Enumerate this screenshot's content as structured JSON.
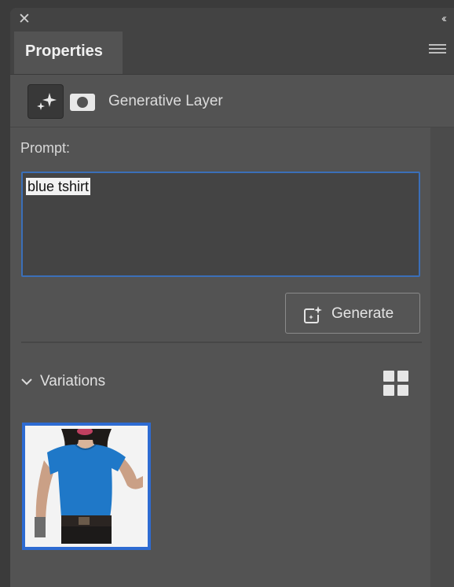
{
  "topbar": {
    "close_glyph": "✕",
    "collapse_glyph": "‹‹"
  },
  "tabs": [
    {
      "label": "Properties",
      "active": true
    }
  ],
  "menu_icon": "hamburger-menu-icon",
  "layer": {
    "title": "Generative Layer",
    "type_icon": "sparkle-icon",
    "mask_icon": "layer-mask-icon"
  },
  "prompt": {
    "label": "Prompt:",
    "value": "blue tshirt",
    "selected": true
  },
  "generate_button": {
    "label": "Generate",
    "icon": "generate-sparkle-icon"
  },
  "variations": {
    "label": "Variations",
    "expanded": true,
    "view_icon": "grid-view-icon",
    "items": [
      {
        "description": "person in blue t-shirt",
        "selected": true
      }
    ]
  },
  "colors": {
    "panel_bg": "#535353",
    "focus_blue": "#3b6fb8",
    "selection_blue": "#2d6bd2",
    "shirt_blue": "#1f78c8"
  }
}
